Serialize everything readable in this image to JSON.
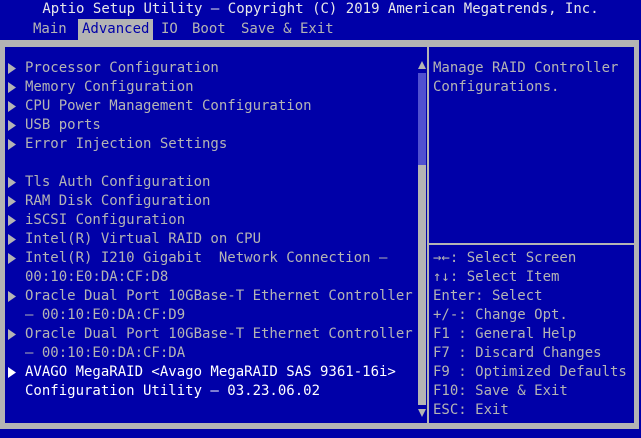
{
  "header": {
    "title": "Aptio Setup Utility – Copyright (C) 2019 American Megatrends, Inc."
  },
  "tabs": [
    {
      "label": "Main",
      "active": false
    },
    {
      "label": "Advanced",
      "active": true
    },
    {
      "label": "IO",
      "active": false
    },
    {
      "label": "Boot",
      "active": false
    },
    {
      "label": "Save & Exit",
      "active": false
    }
  ],
  "menu": {
    "items": [
      {
        "line1": "Processor Configuration",
        "line2": "",
        "active": false
      },
      {
        "line1": "Memory Configuration",
        "line2": "",
        "active": false
      },
      {
        "line1": "CPU Power Management Configuration",
        "line2": "",
        "active": false
      },
      {
        "line1": "USB ports",
        "line2": "",
        "active": false
      },
      {
        "line1": "Error Injection Settings",
        "line2": "",
        "active": false
      },
      {
        "line1": "Tls Auth Configuration",
        "line2": "",
        "active": false
      },
      {
        "line1": "RAM Disk Configuration",
        "line2": "",
        "active": false
      },
      {
        "line1": "iSCSI Configuration",
        "line2": "",
        "active": false
      },
      {
        "line1": "Intel(R) Virtual RAID on CPU",
        "line2": "",
        "active": false
      },
      {
        "line1": "Intel(R) I210 Gigabit  Network Connection –",
        "line2": "00:10:E0:DA:CF:D8",
        "active": false
      },
      {
        "line1": "Oracle Dual Port 10GBase-T Ethernet Controller",
        "line2": "– 00:10:E0:DA:CF:D9",
        "active": false
      },
      {
        "line1": "Oracle Dual Port 10GBase-T Ethernet Controller",
        "line2": "– 00:10:E0:DA:CF:DA",
        "active": false
      },
      {
        "line1": "AVAGO MegaRAID <Avago MegaRAID SAS 9361-16i>",
        "line2": "Configuration Utility – 03.23.06.02",
        "active": true
      }
    ]
  },
  "scrollbar": {
    "up": "▲",
    "down": "▼"
  },
  "help": {
    "text": "Manage RAID Controller Configurations."
  },
  "keys": [
    {
      "glyph": "→←",
      "text": ": Select Screen"
    },
    {
      "glyph": "↑↓",
      "text": ": Select Item"
    },
    {
      "glyph": "",
      "text": "Enter: Select"
    },
    {
      "glyph": "",
      "text": "+/-: Change Opt."
    },
    {
      "glyph": "",
      "text": "F1 : General Help"
    },
    {
      "glyph": "",
      "text": "F7 : Discard Changes"
    },
    {
      "glyph": "",
      "text": "F9 : Optimized Defaults"
    },
    {
      "glyph": "",
      "text": "F10: Save & Exit"
    },
    {
      "glyph": "",
      "text": "ESC: Exit"
    }
  ],
  "colors": {
    "background": "#0000a8",
    "frame": "#b4b4b4",
    "text": "#b4b4b4",
    "highlight": "#ffffff",
    "scroll_track": "#5050d0"
  }
}
